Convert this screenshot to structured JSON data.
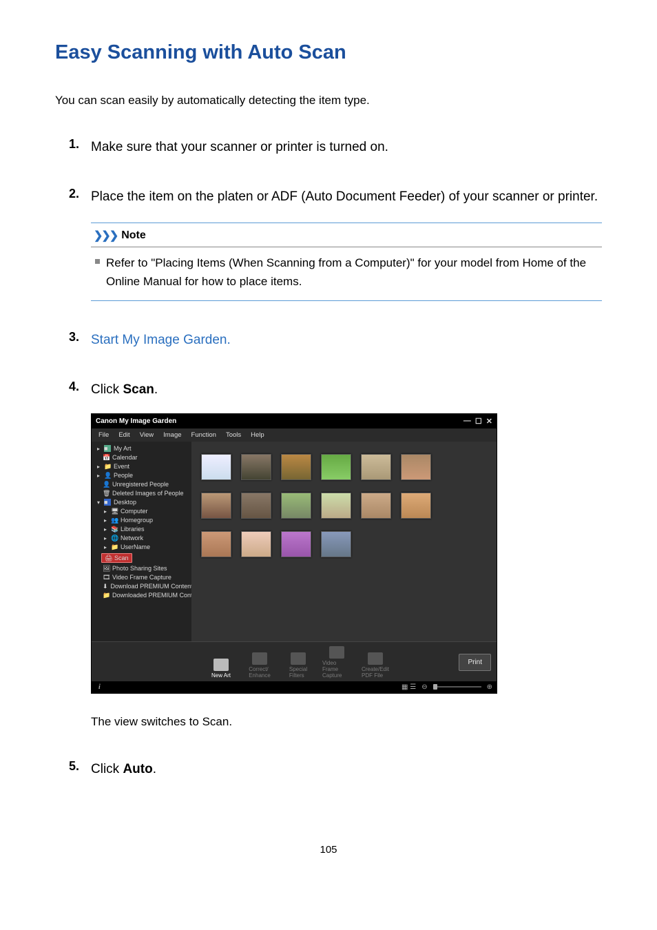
{
  "title": "Easy Scanning with Auto Scan",
  "intro": "You can scan easily by automatically detecting the item type.",
  "steps": {
    "s1": "Make sure that your scanner or printer is turned on.",
    "s2": "Place the item on the platen or ADF (Auto Document Feeder) of your scanner or printer.",
    "s3_link": "Start My Image Garden.",
    "s4_prefix": "Click ",
    "s4_bold": "Scan",
    "s4_suffix": ".",
    "s4_caption_prefix": "The view switches to ",
    "s4_caption_bold": "Scan",
    "s4_caption_suffix": ".",
    "s5_prefix": "Click ",
    "s5_bold": "Auto",
    "s5_suffix": "."
  },
  "note": {
    "label": "Note",
    "text_prefix": "Refer to \"Placing Items (When Scanning from a Computer)\" for your model from Home of the ",
    "italic": "Online Manual",
    "text_suffix": " for how to place items."
  },
  "app": {
    "title": "Canon My Image Garden",
    "menu": {
      "file": "File",
      "edit": "Edit",
      "view": "View",
      "image": "Image",
      "function": "Function",
      "tools": "Tools",
      "help": "Help"
    },
    "side": {
      "my_art": "My Art",
      "calendar": "Calendar",
      "event": "Event",
      "people": "People",
      "unregistered": "Unregistered People",
      "deleted": "Deleted Images of People",
      "desktop": "Desktop",
      "computer": "Computer",
      "homegroup": "Homegroup",
      "libraries": "Libraries",
      "network": "Network",
      "username": "UserName",
      "scan": "Scan",
      "photo_sharing": "Photo Sharing Sites",
      "video_frame": "Video Frame Capture",
      "download_premium": "Download PREMIUM Contents",
      "downloaded_premium": "Downloaded PREMIUM Contents"
    },
    "toolbar": {
      "new_art": "New Art",
      "correct": "Correct/\nEnhance",
      "filters": "Special\nFilters",
      "video": "Video Frame\nCapture",
      "pdf": "Create/Edit\nPDF File",
      "print": "Print"
    },
    "status": {
      "info": "i",
      "minus": "⊖",
      "plus": "⊕"
    }
  },
  "page_number": "105"
}
